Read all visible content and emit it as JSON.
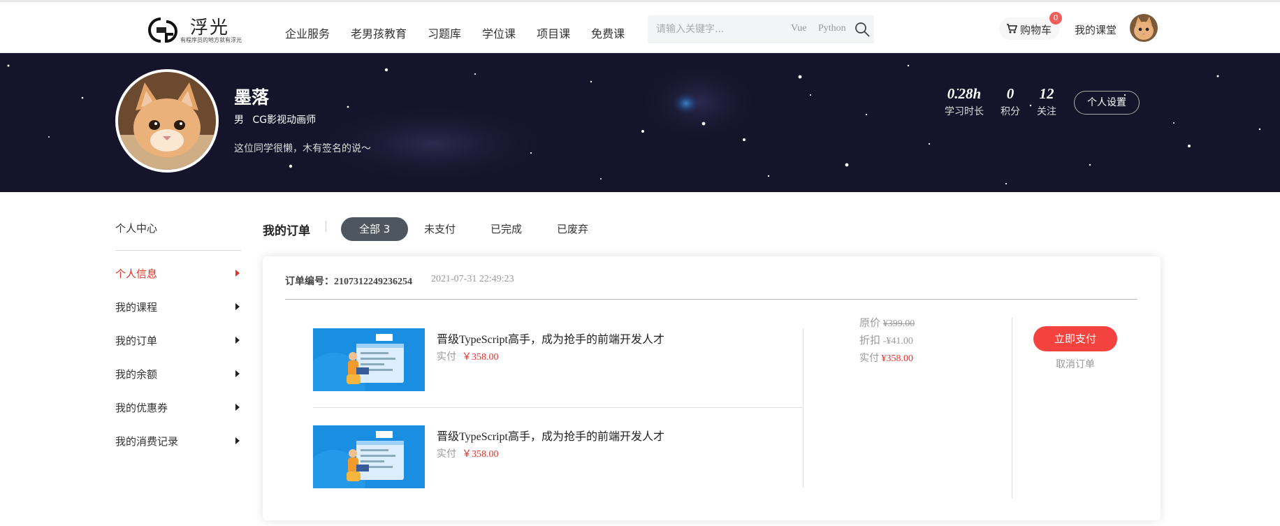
{
  "header": {
    "logo_title": "浮光",
    "logo_sub": "有程序员的地方就有浮光",
    "nav": [
      "企业服务",
      "老男孩教育",
      "习题库",
      "学位课",
      "项目课",
      "免费课"
    ],
    "search_placeholder": "请输入关键字...",
    "search_tags": [
      "Vue",
      "Python"
    ],
    "cart_label": "购物车",
    "cart_count": "0",
    "my_course": "我的课堂"
  },
  "profile": {
    "name": "墨落",
    "gender": "男",
    "title": "CG影视动画师",
    "signature": "这位同学很懒，木有签名的说～",
    "stats": [
      {
        "value": "0.28h",
        "label": "学习时长"
      },
      {
        "value": "0",
        "label": "积分"
      },
      {
        "value": "12",
        "label": "关注"
      }
    ],
    "settings_label": "个人设置"
  },
  "sidebar": {
    "title": "个人中心",
    "items": [
      "个人信息",
      "我的课程",
      "我的订单",
      "我的余额",
      "我的优惠券",
      "我的消费记录"
    ],
    "active": "个人信息"
  },
  "orders": {
    "title": "我的订单",
    "tabs": {
      "all": "全部 3",
      "unpaid": "未支付",
      "done": "已完成",
      "discarded": "已废弃"
    },
    "order": {
      "number": "订单编号：2107312249236254",
      "time": "2021-07-31 22:49:23",
      "items": [
        {
          "title": "晋级TypeScript高手，成为抢手的前端开发人才",
          "price_label": "实付",
          "price": "￥358.00"
        },
        {
          "title": "晋级TypeScript高手，成为抢手的前端开发人才",
          "price_label": "实付",
          "price": "￥358.00"
        }
      ],
      "original_label": "原价",
      "original_price": "¥399.00",
      "discount_label": "折扣",
      "discount": "-¥41.00",
      "paid_label": "实付",
      "paid": "¥358.00",
      "pay_button": "立即支付",
      "cancel": "取消订单"
    }
  },
  "colors": {
    "accent_red": "#f4433e",
    "tab_active": "#4e5660",
    "banner_bg": "#15142a"
  }
}
